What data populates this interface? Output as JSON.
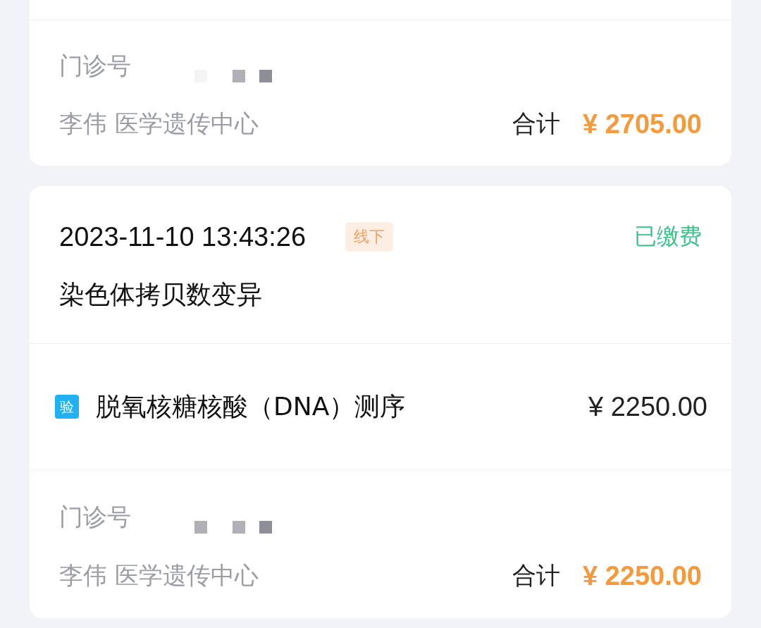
{
  "orders": [
    {
      "partial": true,
      "outpatient_label": "门诊号",
      "masked": true,
      "doctor": "李伟",
      "department": "医学遗传中心",
      "total_label": "合计",
      "total": "¥ 2705.00"
    },
    {
      "partial": false,
      "datetime": "2023-11-10 13:43:26",
      "channel": "线下",
      "status": "已缴费",
      "title": "染色体拷贝数变异",
      "items": [
        {
          "badge": "验",
          "name": "脱氧核糖核酸（DNA）测序",
          "price": "¥ 2250.00"
        }
      ],
      "outpatient_label": "门诊号",
      "masked": true,
      "doctor": "李伟",
      "department": "医学遗传中心",
      "total_label": "合计",
      "total": "¥ 2250.00"
    }
  ]
}
